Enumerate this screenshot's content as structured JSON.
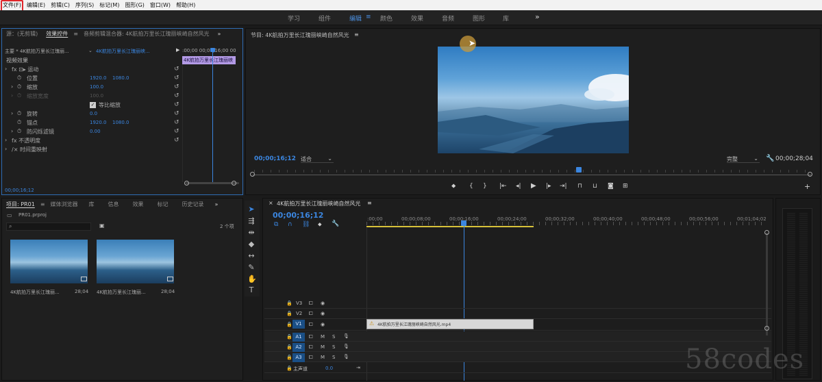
{
  "menu": [
    "文件(F)",
    "编辑(E)",
    "剪辑(C)",
    "序列(S)",
    "标记(M)",
    "图形(G)",
    "窗口(W)",
    "帮助(H)"
  ],
  "workspaces": [
    {
      "label": "学习",
      "active": false
    },
    {
      "label": "组件",
      "active": false
    },
    {
      "label": "编辑",
      "active": true
    },
    {
      "label": "≡",
      "active": false
    },
    {
      "label": "颜色",
      "active": false
    },
    {
      "label": "效果",
      "active": false
    },
    {
      "label": "音频",
      "active": false
    },
    {
      "label": "图形",
      "active": false
    },
    {
      "label": "库",
      "active": false
    },
    {
      "label": "»",
      "active": false
    }
  ],
  "source_tabs": [
    "源：(无剪辑)",
    "效果控件",
    "≡",
    "音频剪辑混合器: 4K航拍万里长江瑰丽峡崎自然风光",
    "»"
  ],
  "effect_controls": {
    "master": "主要 * 4K航拍万里长江瑰丽...",
    "clip": "4K航拍万里长江瑰丽峡...",
    "timecode_ruler": ":00;00    00;00;16;00    00",
    "clip_bar": "4K航拍万里长江瑰丽峡",
    "section": "视频效果",
    "rows": [
      {
        "label": "fx  ⊡▸  运动",
        "v1": "",
        "v2": ""
      },
      {
        "label": "位置",
        "v1": "1920.0",
        "v2": "1080.0"
      },
      {
        "label": "缩放",
        "v1": "100.0",
        "v2": ""
      },
      {
        "label": "缩放宽度",
        "v1": "100.0",
        "v2": ""
      },
      {
        "label": "等比缩放",
        "v1": "",
        "v2": ""
      },
      {
        "label": "旋转",
        "v1": "0.0",
        "v2": ""
      },
      {
        "label": "锚点",
        "v1": "1920.0",
        "v2": "1080.0"
      },
      {
        "label": "防闪烁滤镜",
        "v1": "0.00",
        "v2": ""
      },
      {
        "label": "fx  不透明度",
        "v1": "",
        "v2": ""
      },
      {
        "label": "/×  时间重映射",
        "v1": "",
        "v2": ""
      }
    ],
    "timecode": "00;00;16;12"
  },
  "program": {
    "title": "节目: 4K航拍万里长江瑰丽峡崎自然风光",
    "menu_icon": "≡",
    "timecode": "00;00;16;12",
    "fit": "适合",
    "quality": "完整",
    "duration": "00;00;28;04"
  },
  "project": {
    "tabs": [
      "项目: PR01",
      "≡",
      "媒体浏览器",
      "库",
      "信息",
      "效果",
      "标记",
      "历史记录",
      "»"
    ],
    "file": "PR01.prproj",
    "count": "2 个项",
    "items": [
      {
        "name": "4K航拍万里长江瑰丽...",
        "dur": "28;04"
      },
      {
        "name": "4K航拍万里长江瑰丽...",
        "dur": "28;04"
      }
    ]
  },
  "timeline": {
    "title": "4K航拍万里长江瑰丽峡崎自然风光",
    "menu_icon": "≡",
    "timecode": "00;00;16;12",
    "ruler": [
      ":00;00",
      "00;00;08;00",
      "00;00;16;00",
      "00;00;24;00",
      "00;00;32;00",
      "00;00;40;00",
      "00;00;48;00",
      "00;00;56;00",
      "00;01;04;02"
    ],
    "tracks": [
      "V3",
      "V2",
      "V1",
      "A1",
      "A2",
      "A3"
    ],
    "master": "主声道",
    "master_val": "0.0",
    "clip": "4K航拍万里长江瑰丽峡崎自然风光.mp4",
    "audio_controls": [
      "M",
      "S"
    ]
  },
  "watermark": "58codes",
  "colors": {
    "accent": "#3b86e0",
    "highlight": "#e0262a",
    "clip": "#d7d7d7"
  }
}
